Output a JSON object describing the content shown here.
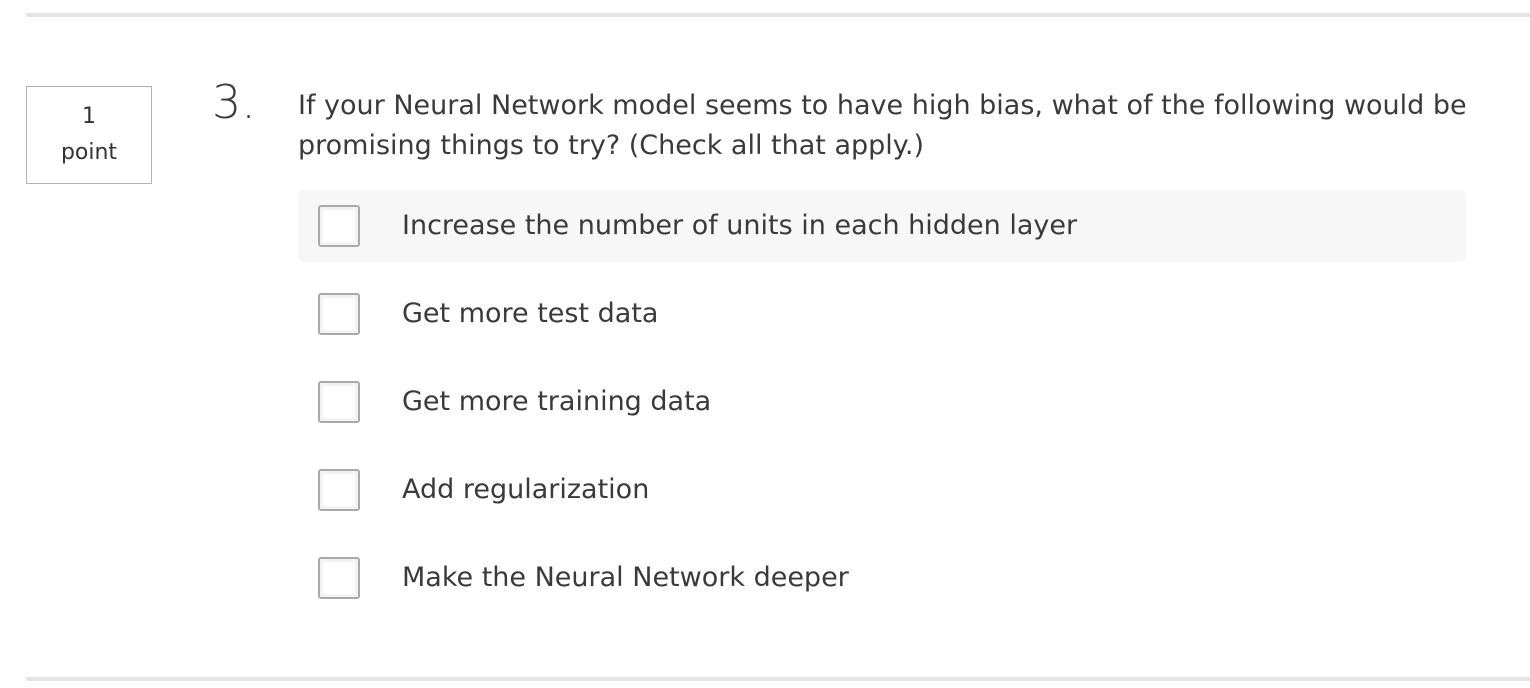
{
  "question": {
    "points_value": "1",
    "points_unit": "point",
    "number": "3.",
    "text": "If your Neural Network model seems to have high bias, what of the following would be promising things to try? (Check all that apply.)",
    "options": [
      {
        "label": "Increase the number of units in each hidden layer",
        "checked": false
      },
      {
        "label": "Get more test data",
        "checked": false
      },
      {
        "label": "Get more training data",
        "checked": false
      },
      {
        "label": "Add regularization",
        "checked": false
      },
      {
        "label": "Make the Neural Network deeper",
        "checked": false
      }
    ]
  }
}
